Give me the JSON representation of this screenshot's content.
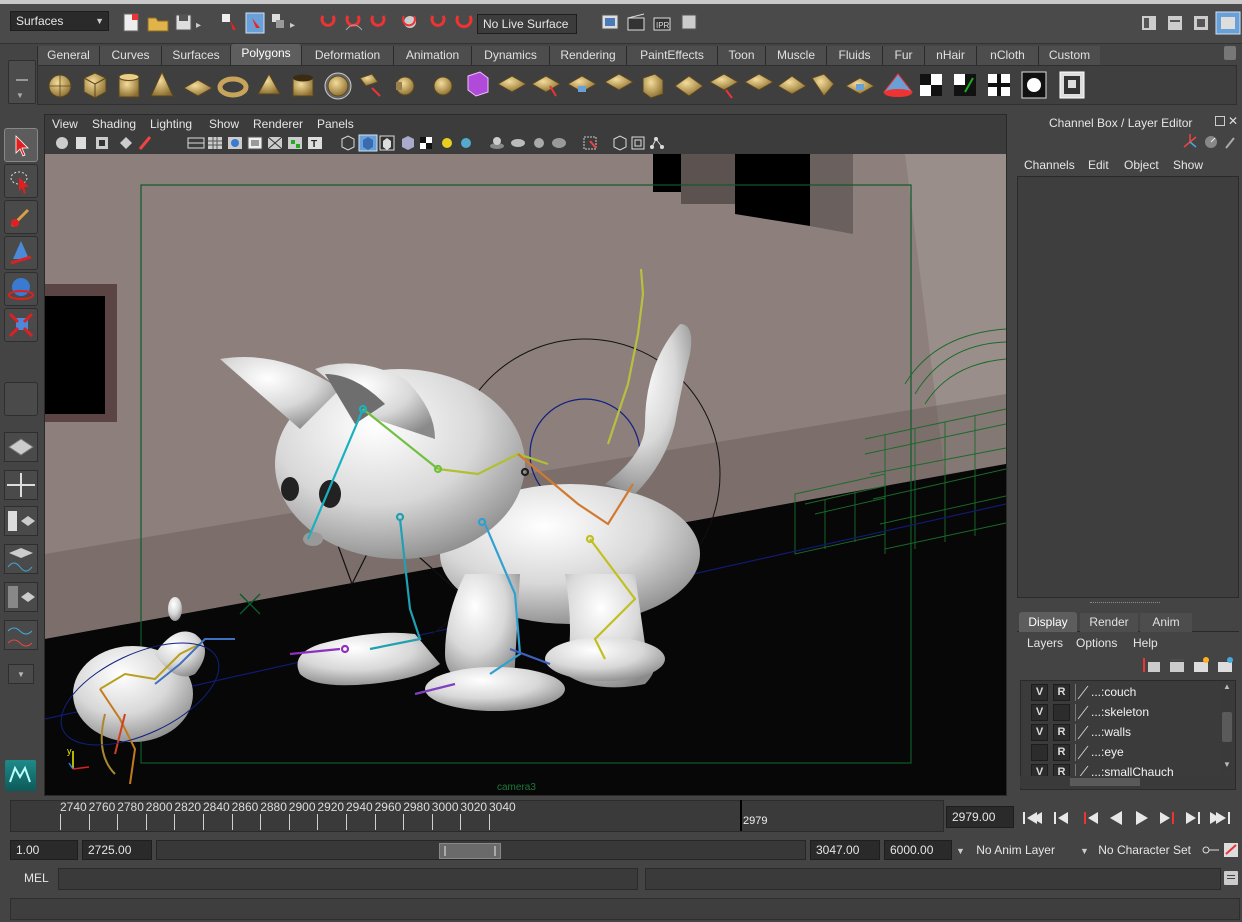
{
  "status_line": {
    "menu_set": "Surfaces",
    "live_surface": "No Live Surface"
  },
  "shelf": {
    "tabs": [
      "General",
      "Curves",
      "Surfaces",
      "Polygons",
      "Deformation",
      "Animation",
      "Dynamics",
      "Rendering",
      "PaintEffects",
      "Toon",
      "Muscle",
      "Fluids",
      "Fur",
      "nHair",
      "nCloth",
      "Custom"
    ],
    "active_tab": "Polygons"
  },
  "viewport": {
    "menus": [
      "View",
      "Shading",
      "Lighting",
      "Show",
      "Renderer",
      "Panels"
    ],
    "camera_label": "camera3"
  },
  "channel_box": {
    "title": "Channel Box / Layer Editor",
    "menus": [
      "Channels",
      "Edit",
      "Object",
      "Show"
    ]
  },
  "layer_editor": {
    "tabs": [
      "Display",
      "Render",
      "Anim"
    ],
    "active_tab": "Display",
    "menus": [
      "Layers",
      "Options",
      "Help"
    ],
    "layers": [
      {
        "v": "V",
        "r": "R",
        "name": "...:couch"
      },
      {
        "v": "V",
        "r": "",
        "name": "...:skeleton"
      },
      {
        "v": "V",
        "r": "R",
        "name": "...:walls"
      },
      {
        "v": "",
        "r": "R",
        "name": "...:eye"
      },
      {
        "v": "V",
        "r": "R",
        "name": "...:smallChauch"
      }
    ]
  },
  "time_slider": {
    "ticks": [
      "2740",
      "2760",
      "2780",
      "2800",
      "2820",
      "2840",
      "2860",
      "2880",
      "2900",
      "2920",
      "2940",
      "2960",
      "2980",
      "3000",
      "3020",
      "3040"
    ],
    "current_frame_marker": "2979",
    "current_time": "2979.00"
  },
  "range_slider": {
    "start_time": "1.00",
    "range_start": "2725.00",
    "range_end": "3047.00",
    "end_time": "6000.00",
    "anim_layer": "No Anim Layer",
    "character_set": "No Character Set"
  },
  "command_line": {
    "label": "MEL"
  }
}
